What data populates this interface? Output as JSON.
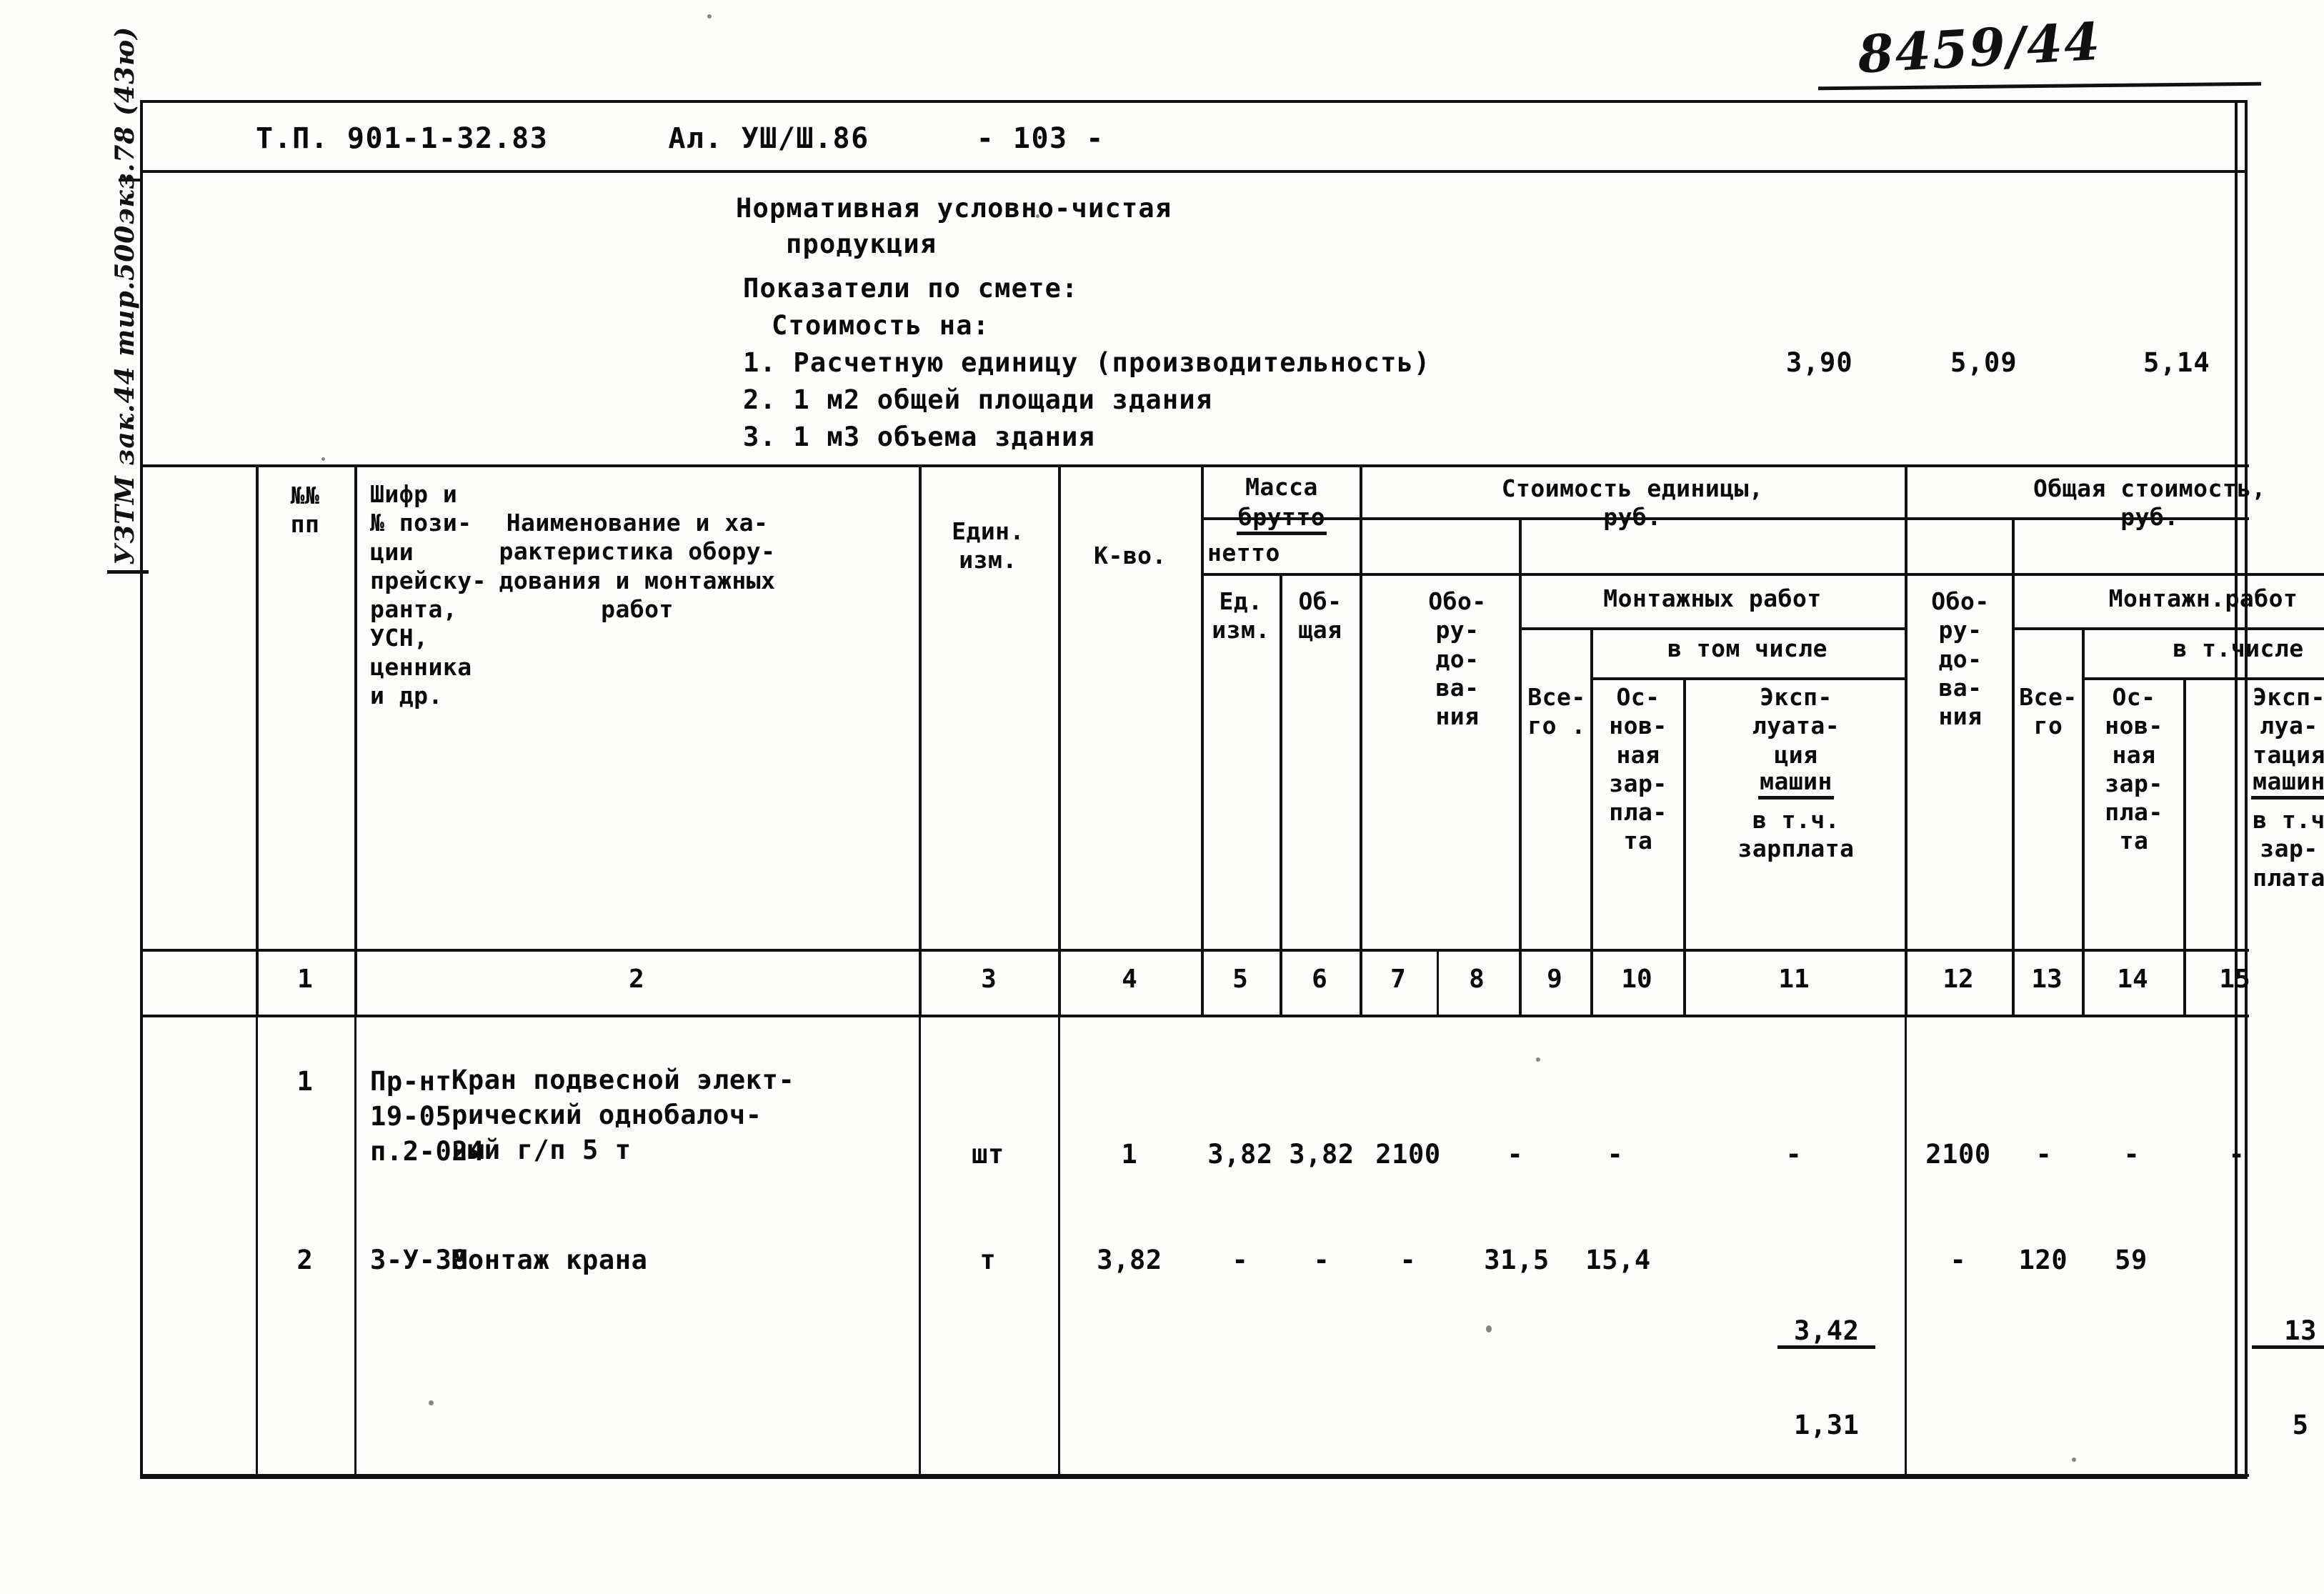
{
  "page": {
    "handwritten_number": "8459/44",
    "margin_stamp": "УЗТМ зак.44 тир.500экз.78 (43ю)"
  },
  "header": {
    "project_code": "Т.П. 901-1-32.83",
    "album": "Ал. УШ/Ш.86",
    "page_label": "- 103 -"
  },
  "title": {
    "line1": "Нормативная условно-чистая",
    "line2": "продукция",
    "line3": "Показатели по смете:",
    "line4": "Стоимость на:",
    "item1": "1. Расчетную единицу (производительность)",
    "item2": "2. 1 м2 общей площади здания",
    "item3": "3. 1 м3 объема здания",
    "value1": "3,90",
    "value2": "5,09",
    "value3": "5,14"
  },
  "table": {
    "headers": {
      "col1": "№№\nпп",
      "col2": "Шифр и\n№ пози-\nции\nпрейску-\nранта,\nУСН,\nценника\nи др.",
      "col3": "Наименование и ха-\nрактеристика обору-\nдования и монтажных\nработ",
      "col4": "Един.\nизм.",
      "col5": "К-во.",
      "mass_group": "Масса",
      "mass_brutto": "брутто",
      "mass_netto": "нетто",
      "col6": "Ед.\nизм.",
      "col7": "Об-\nщая",
      "unit_cost_group": "Стоимость единицы,\nруб.",
      "col8": "Обо-\nру-\nдо-\nва-\nния",
      "mont_works_1": "Монтажных работ",
      "in_which_1": "в том числе",
      "col9": "Все-\nго .",
      "col10": "Ос-\nнов-\nная\nзар-\nпла-\nта",
      "col11_a": "Эксп-\nлуата-\nция",
      "col11_b": "машин",
      "col11_c": "в т.ч.\nзарплата",
      "total_cost_group": "Общая стоимость,\nруб.",
      "col12": "Обо-\nру-\nдо-\nва-\nния",
      "mont_works_2": "Монтажн.работ",
      "in_which_2": "в т.числе",
      "col13": "Все-\nго",
      "col14": "Ос-\nнов-\nная\nзар-\nпла-\nта",
      "col15_a": "Эксп-\nлуа-\nтация",
      "col15_b": "машин",
      "col15_c": "в т.ч\nзар-\nплата"
    },
    "column_numbers": [
      "1",
      "2",
      "3",
      "4",
      "5",
      "6",
      "7",
      "8",
      "9",
      "10",
      "11",
      "12",
      "13",
      "14",
      "15"
    ],
    "rows": [
      {
        "n": "1",
        "code": "Пр-нт\n19-05\nп.2-024",
        "name": "Кран подвесной элект-\nрический однобалоч-\nный г/п 5 т",
        "unit": "шт",
        "qty": "1",
        "mass_unit": "3,82",
        "mass_total": "3,82",
        "equip_unit": "2100",
        "mont_total_unit": "-",
        "mont_wage_unit": "-",
        "mont_mach_unit_top": "-",
        "mont_mach_unit_bot": "",
        "equip_total": "2100",
        "mont_total": "-",
        "mont_wage_total": "-",
        "mont_mach_total_top": "-",
        "mont_mach_total_bot": ""
      },
      {
        "n": "2",
        "code": "3-У-38",
        "name": "Монтаж крана",
        "unit": "т",
        "qty": "3,82",
        "mass_unit": "-",
        "mass_total": "-",
        "equip_unit": "-",
        "mont_total_unit": "31,5",
        "mont_wage_unit": "15,4",
        "mont_mach_unit_top": "3,42",
        "mont_mach_unit_bot": "1,31",
        "equip_total": "-",
        "mont_total": "120",
        "mont_wage_total": "59",
        "mont_mach_total_top": "13",
        "mont_mach_total_bot": "5"
      }
    ]
  }
}
